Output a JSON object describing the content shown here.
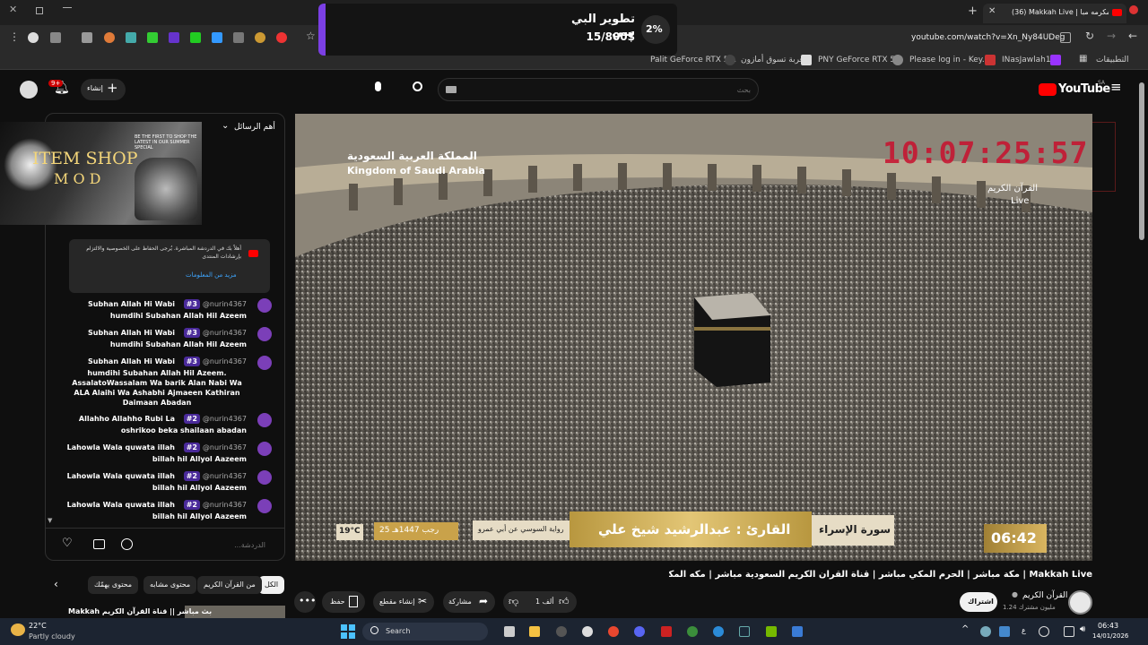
{
  "browser": {
    "tab_count_title": "(36) Makkah Live | مكه المكرمه مبا",
    "url": "youtube.com/watch?v=Xn_Ny84UDeg",
    "bookmarks": [
      "Palit GeForce RTX 5...",
      "عربة تسوق أمازون",
      "PNY GeForce RTX 5...",
      "Please log in - Key...",
      "INasJawlah18",
      "التطبيقات"
    ]
  },
  "popup": {
    "title": "تطوير البي سي",
    "amount": "15/800$",
    "percent": "2%",
    "progress_fraction": 0.02
  },
  "youtube": {
    "logo": "YouTube",
    "logo_country": "SA",
    "create_label": "إنشاء",
    "notif_count": "9+",
    "search_placeholder": "بحث"
  },
  "chat": {
    "header": "أهم الرسائل",
    "overlay_line1": "ITEM SHOP",
    "overlay_line2": "M O D",
    "overlay_small": "BE THE FIRST TO SHOP THE LATEST IN OUR SUMMER SPECIAL",
    "notice": "أهلاً بك في الدردشة المباشرة. يُرجى الحفاظ على الخصوصية والالتزام بإرشادات المنتدى",
    "notice_link": "مزيد من المعلومات",
    "messages": [
      {
        "user": "@nurin4367",
        "badge": "#3",
        "first": "Subhan Allah Hi Wabi",
        "body": "humdihi Subahan Allah Hil Azeem"
      },
      {
        "user": "@nurin4367",
        "badge": "#3",
        "first": "Subhan Allah Hi Wabi",
        "body": "humdihi Subahan Allah Hil Azeem"
      },
      {
        "user": "@nurin4367",
        "badge": "#3",
        "first": "Subhan Allah Hi Wabi",
        "body": "humdihi Subahan Allah Hil Azeem. AssalatoWassalam Wa barik Alan Nabi Wa ALA Alaihi Wa Ashabhi Ajmaeen Kathiran Daimaan Abadan"
      },
      {
        "user": "@nurin4367",
        "badge": "#2",
        "first": "Allahho Allahho Rubi La",
        "body": "oshrikoo beka shailaan abadan"
      },
      {
        "user": "@nurin4367",
        "badge": "#2",
        "first": "Lahowla Wala quwata illah",
        "body": "billah hil Allyol Aazeem"
      },
      {
        "user": "@nurin4367",
        "badge": "#2",
        "first": "Lahowla Wala quwata illah",
        "body": "billah hil Allyol Aazeem"
      },
      {
        "user": "@nurin4367",
        "badge": "#2",
        "first": "Lahowla Wala quwata illah",
        "body": "billah hil Allyol Aazeem"
      }
    ],
    "input_placeholder": "الدردشة..."
  },
  "video": {
    "kingdom_ar": "المملكة العربية السعودية",
    "kingdom_en": "Kingdom of Saudi Arabia",
    "clock": "10:07:25:57",
    "channel_ar": "القرآن الكريم",
    "live": "Live",
    "surah": "سورة الإسراء",
    "reciter": "القارئ : عبدالرشيد شيخ علي",
    "narration": "رواية السوسي عن أبي عمرو",
    "hijri": "25 رجب 1447هـ",
    "temp": "19°C",
    "time": "06:42"
  },
  "below": {
    "title": "Makkah Live | مكة مباشر | الحرم المكي مباشر | قناة القرآن الكريم السعودية مباشر | مكه المكرمه مبا",
    "channel": "القرآن الكريم",
    "subs": "1.24 مليون مشترك",
    "subscribe": "اشتراك",
    "likes": "1 ألف",
    "share": "مشاركة",
    "clip": "إنشاء مقطع",
    "save": "حفظ",
    "chips": [
      "الكل",
      "من القرآن الكريم",
      "محتوى مشابه",
      "محتوى يهمّك"
    ],
    "next_title": "Makkah بث مباشر || قناة القرآن الكريم"
  },
  "taskbar": {
    "temp": "22°C",
    "weather": "Partly cloudy",
    "search": "Search",
    "time": "06:43",
    "date": "14/01/2026",
    "lang": "ع"
  },
  "colors": {
    "accent": "#7b3fe4",
    "yt_red": "#ff0000",
    "clock_red": "#c8102e",
    "gold": "#c9a24a"
  }
}
